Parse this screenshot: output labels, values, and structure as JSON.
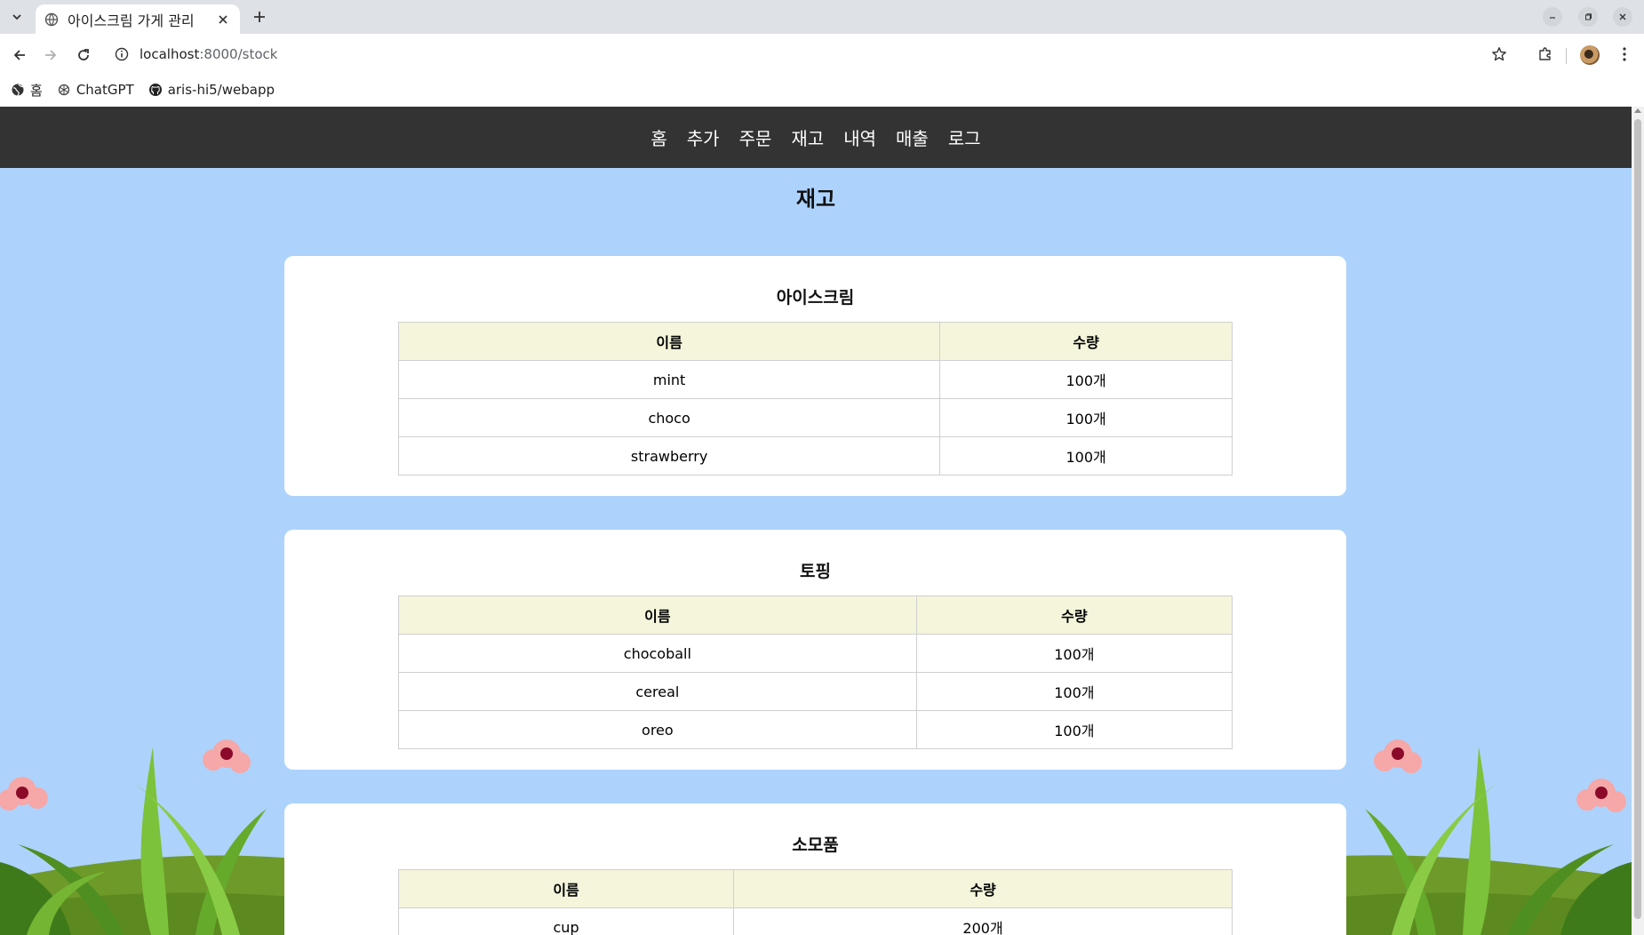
{
  "browser": {
    "tab_title": "아이스크림 가게 관리",
    "url_host": "localhost",
    "url_path": ":8000/stock",
    "bookmarks": [
      {
        "label": "홈",
        "icon": "globe-icon"
      },
      {
        "label": "ChatGPT",
        "icon": "chatgpt-icon"
      },
      {
        "label": "aris-hi5/webapp",
        "icon": "github-icon"
      }
    ]
  },
  "nav": {
    "items": [
      "홈",
      "추가",
      "주문",
      "재고",
      "내역",
      "매출",
      "로그"
    ]
  },
  "page": {
    "title": "재고"
  },
  "sections": [
    {
      "title": "아이스크림",
      "headers": [
        "이름",
        "수량"
      ],
      "rows": [
        {
          "name": "mint",
          "qty": "100개"
        },
        {
          "name": "choco",
          "qty": "100개"
        },
        {
          "name": "strawberry",
          "qty": "100개"
        }
      ]
    },
    {
      "title": "토핑",
      "headers": [
        "이름",
        "수량"
      ],
      "rows": [
        {
          "name": "chocoball",
          "qty": "100개"
        },
        {
          "name": "cereal",
          "qty": "100개"
        },
        {
          "name": "oreo",
          "qty": "100개"
        }
      ]
    },
    {
      "title": "소모품",
      "headers": [
        "이름",
        "수량"
      ],
      "rows": [
        {
          "name": "cup",
          "qty": "200개"
        }
      ]
    }
  ],
  "colors": {
    "page_background": "#add3fc",
    "nav_background": "#333333",
    "table_header": "#f5f5dc",
    "card": "#ffffff"
  }
}
